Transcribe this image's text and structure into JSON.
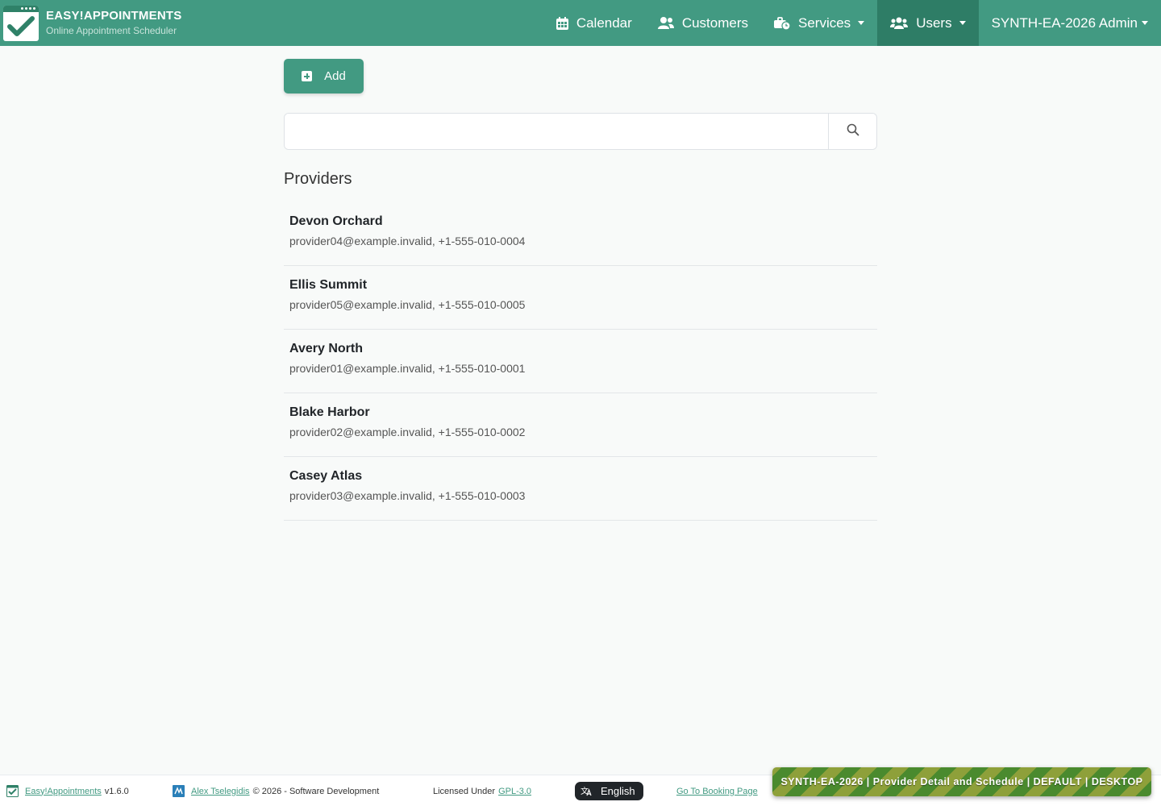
{
  "header": {
    "brand_title": "EASY!APPOINTMENTS",
    "brand_subtitle": "Online Appointment Scheduler",
    "nav": {
      "calendar": "Calendar",
      "customers": "Customers",
      "services": "Services",
      "users": "Users",
      "account": "SYNTH-EA-2026 Admin"
    },
    "active_nav": "Users",
    "colors": {
      "header_bg": "#429a82",
      "active_bg": "#2e7d66"
    }
  },
  "toolbar": {
    "add_label": "Add"
  },
  "search": {
    "value": "",
    "placeholder": "",
    "icon": "search-icon"
  },
  "list": {
    "title": "Providers",
    "items": [
      {
        "name": "Devon Orchard",
        "info": "provider04@example.invalid, +1-555-010-0004"
      },
      {
        "name": "Ellis Summit",
        "info": "provider05@example.invalid, +1-555-010-0005"
      },
      {
        "name": "Avery North",
        "info": "provider01@example.invalid, +1-555-010-0001"
      },
      {
        "name": "Blake Harbor",
        "info": "provider02@example.invalid, +1-555-010-0002"
      },
      {
        "name": "Casey Atlas",
        "info": "provider03@example.invalid, +1-555-010-0003"
      }
    ]
  },
  "footer": {
    "app_link": "Easy!Appointments",
    "version": "v1.6.0",
    "author_link": "Alex Tselegidis",
    "copyright": "© 2026 - Software Development",
    "license_prefix": "Licensed Under",
    "license_link": "GPL-3.0",
    "language": "English",
    "booking_link": "Go To Booking Page",
    "banner": "SYNTH-EA-2026 | Provider Detail and Schedule | DEFAULT | DESKTOP"
  }
}
